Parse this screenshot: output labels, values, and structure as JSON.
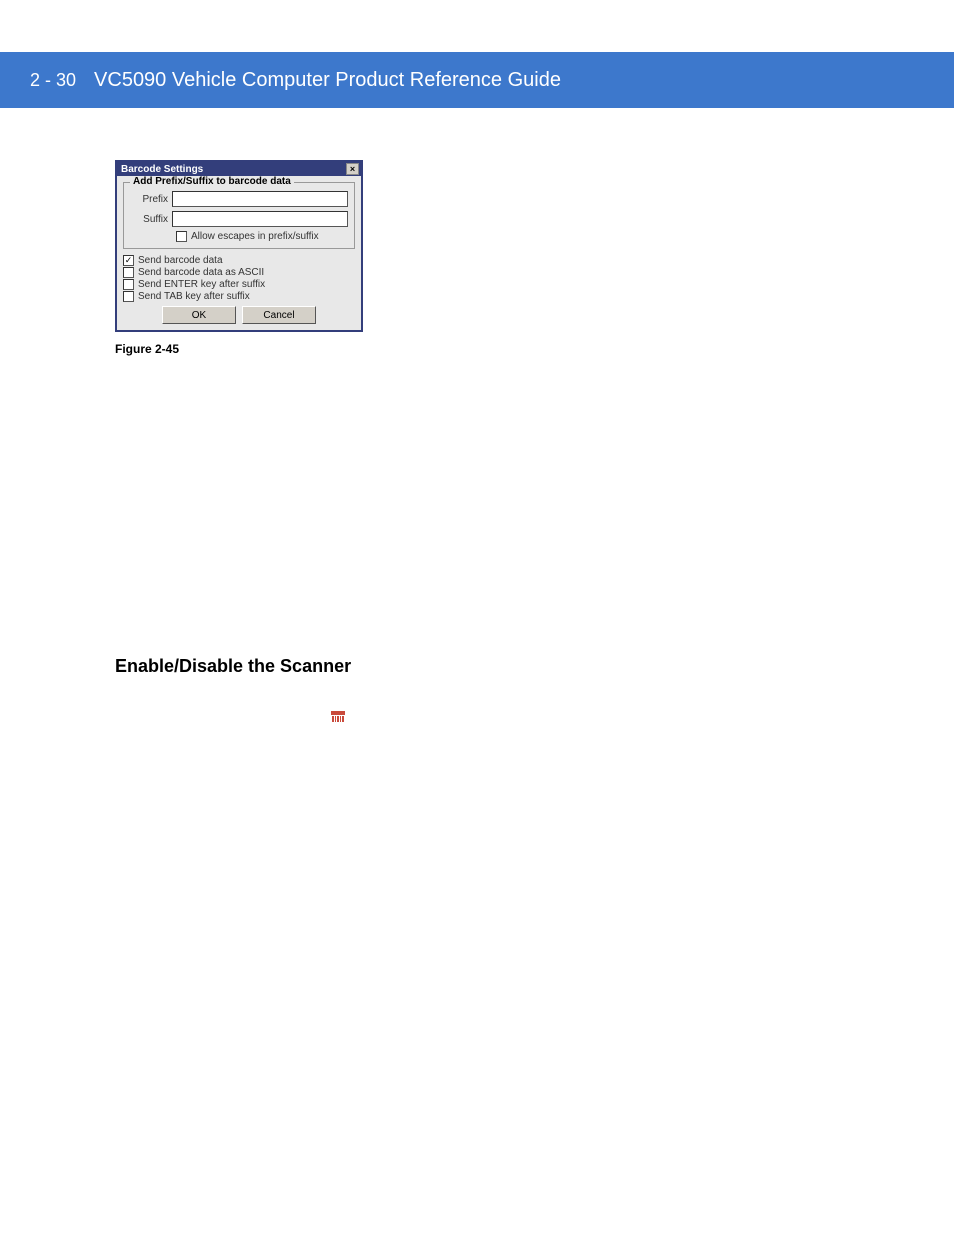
{
  "header": {
    "page_number": "2 - 30",
    "doc_title": "VC5090 Vehicle Computer Product Reference Guide"
  },
  "dialog": {
    "title": "Barcode Settings",
    "groupbox_title": "Add Prefix/Suffix to barcode data",
    "prefix_label": "Prefix",
    "suffix_label": "Suffix",
    "allow_escapes_label": "Allow escapes in prefix/suffix",
    "checks": {
      "send_barcode_data": "Send barcode data",
      "send_ascii": "Send barcode data as ASCII",
      "send_enter": "Send ENTER key after suffix",
      "send_tab": "Send TAB key after suffix"
    },
    "ok_label": "OK",
    "cancel_label": "Cancel"
  },
  "figure_caption": "Figure 2-45",
  "section_heading": "Enable/Disable the Scanner",
  "icon_name": "serialwedge-tray-icon"
}
